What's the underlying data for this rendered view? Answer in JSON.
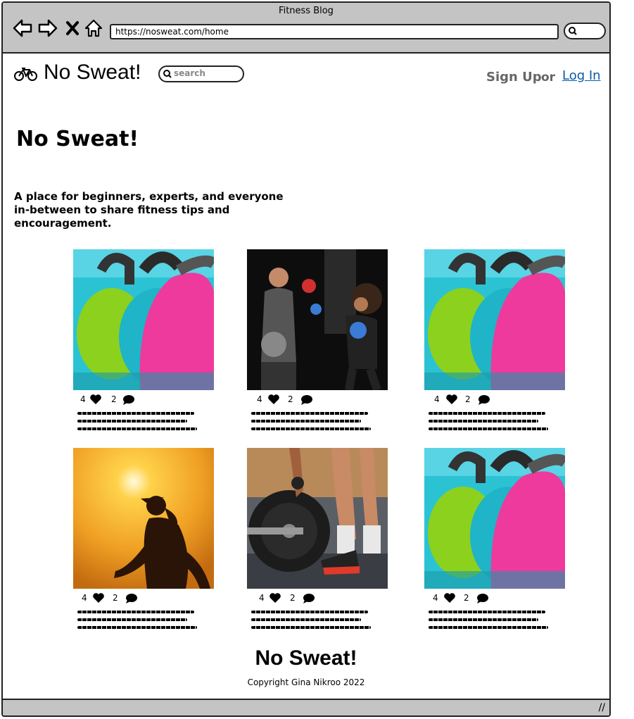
{
  "window": {
    "title": "Fitness Blog",
    "url": "https://nosweat.com/home"
  },
  "header": {
    "brand": "No Sweat!",
    "search_placeholder": "search",
    "signup_label": "Sign Up",
    "or_label": "or",
    "login_label": "Log In"
  },
  "hero": {
    "title": "No Sweat!",
    "tagline_line1": "A place for beginners, experts, and everyone",
    "tagline_line2": "in-between to share fitness tips and encouragement."
  },
  "posts": [
    {
      "image": "kettlebells-image",
      "likes": "4",
      "comments": "2"
    },
    {
      "image": "boxing-training-image",
      "likes": "4",
      "comments": "2"
    },
    {
      "image": "kettlebells-image",
      "likes": "4",
      "comments": "2"
    },
    {
      "image": "sunset-runner-image",
      "likes": "4",
      "comments": "2"
    },
    {
      "image": "barbell-weight-image",
      "likes": "4",
      "comments": "2"
    },
    {
      "image": "kettlebells-image",
      "likes": "4",
      "comments": "2"
    }
  ],
  "footer": {
    "title": "No Sweat!",
    "copyright": "Copyright Gina Nikroo 2022"
  },
  "colors": {
    "link": "#0a5aa8",
    "chrome": "#c4c4c4",
    "muted": "#666666"
  }
}
